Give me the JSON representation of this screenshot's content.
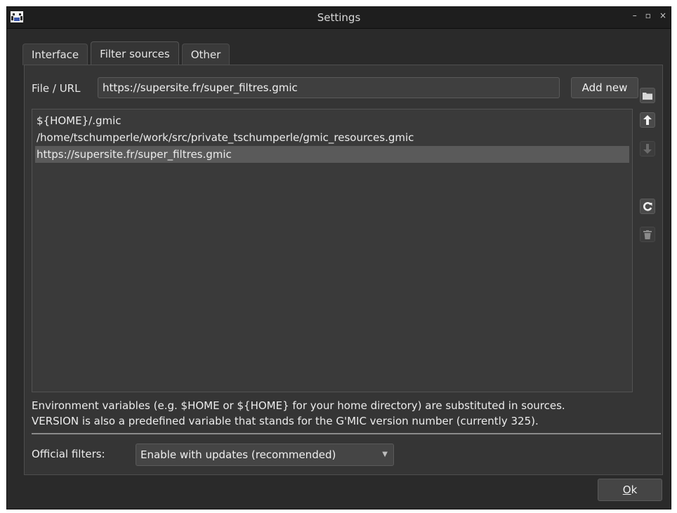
{
  "window": {
    "title": "Settings",
    "controls": {
      "minimize": "–",
      "maximize": "▫",
      "close": "×"
    }
  },
  "tabs": [
    {
      "label": "Interface",
      "active": false
    },
    {
      "label": "Filter sources",
      "active": true
    },
    {
      "label": "Other",
      "active": false
    }
  ],
  "filter_sources": {
    "file_label": "File / URL",
    "file_value": "https://supersite.fr/super_filtres.gmic",
    "add_button": "Add new",
    "sources": [
      "${HOME}/.gmic",
      "/home/tschumperle/work/src/private_tschumperle/gmic_resources.gmic",
      "https://supersite.fr/super_filtres.gmic"
    ],
    "selected_index": 2,
    "info_line1": "Environment variables (e.g. $HOME or ${HOME} for your home directory) are substituted in sources.",
    "info_line2": "VERSION is also a predefined variable that stands for the G'MIC version number (currently 325).",
    "official_label": "Official filters:",
    "official_value": "Enable with updates (recommended)"
  },
  "footer": {
    "ok_label": "Ok",
    "ok_mnemonic": "O",
    "ok_rest": "k"
  },
  "icons": [
    "app-icon",
    "folder-icon",
    "arrow-up-icon",
    "arrow-down-icon",
    "reload-icon",
    "trash-icon",
    "chevron-down-icon"
  ]
}
